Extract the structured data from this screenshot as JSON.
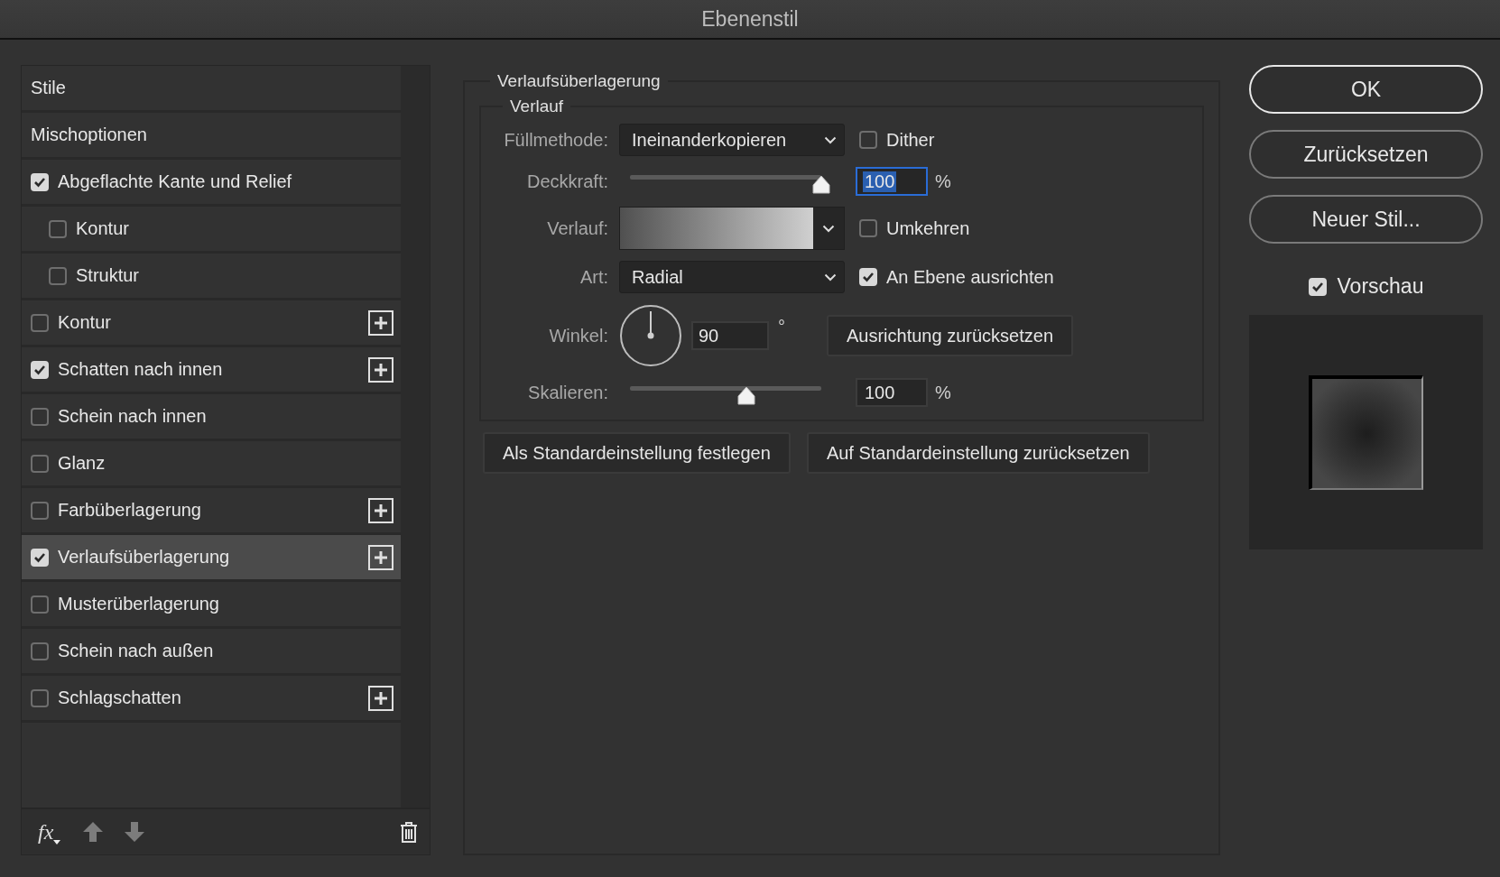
{
  "window": {
    "title": "Ebenenstil"
  },
  "styles_list": {
    "items": [
      {
        "label": "Stile",
        "kind": "plain",
        "selected": false,
        "add_button": false
      },
      {
        "label": "Mischoptionen",
        "kind": "plain",
        "selected": false,
        "add_button": false
      },
      {
        "label": "Abgeflachte Kante und Relief",
        "kind": "check",
        "checked": true,
        "selected": false,
        "add_button": false,
        "children": [
          {
            "label": "Kontur",
            "kind": "check",
            "checked": false,
            "selected": false,
            "add_button": false
          },
          {
            "label": "Struktur",
            "kind": "check",
            "checked": false,
            "selected": false,
            "add_button": false
          }
        ]
      },
      {
        "label": "Kontur",
        "kind": "check",
        "checked": false,
        "selected": false,
        "add_button": true
      },
      {
        "label": "Schatten nach innen",
        "kind": "check",
        "checked": true,
        "selected": false,
        "add_button": true
      },
      {
        "label": "Schein nach innen",
        "kind": "check",
        "checked": false,
        "selected": false,
        "add_button": false
      },
      {
        "label": "Glanz",
        "kind": "check",
        "checked": false,
        "selected": false,
        "add_button": false
      },
      {
        "label": "Farbüberlagerung",
        "kind": "check",
        "checked": false,
        "selected": false,
        "add_button": true
      },
      {
        "label": "Verlaufsüberlagerung",
        "kind": "check",
        "checked": true,
        "selected": true,
        "add_button": true
      },
      {
        "label": "Musterüberlagerung",
        "kind": "check",
        "checked": false,
        "selected": false,
        "add_button": false
      },
      {
        "label": "Schein nach außen",
        "kind": "check",
        "checked": false,
        "selected": false,
        "add_button": false
      },
      {
        "label": "Schlagschatten",
        "kind": "check",
        "checked": false,
        "selected": false,
        "add_button": true
      }
    ],
    "footer": {
      "effects_button": "fx"
    }
  },
  "settings": {
    "title": "Verlaufsüberlagerung",
    "group_title": "Verlauf",
    "blend_mode": {
      "label": "Füllmethode:",
      "value": "Ineinanderkopieren"
    },
    "dither": {
      "label": "Dither",
      "checked": false
    },
    "opacity": {
      "label": "Deckkraft:",
      "level": 1,
      "value": "100",
      "unit": "%",
      "focused": true
    },
    "gradient": {
      "label": "Verlauf:"
    },
    "reverse": {
      "label": "Umkehren",
      "checked": false
    },
    "style": {
      "label": "Art:",
      "value": "Radial"
    },
    "align_with_layer": {
      "label": "An Ebene ausrichten",
      "checked": true
    },
    "angle": {
      "label": "Winkel:",
      "value": "90",
      "unit": "°"
    },
    "reset_alignment": "Ausrichtung zurücksetzen",
    "scale": {
      "label": "Skalieren:",
      "level": 0.61,
      "value": "100",
      "unit": "%",
      "focused": false
    },
    "buttons": [
      "Als Standardeinstellung festlegen",
      "Auf Standardeinstellung zurücksetzen"
    ]
  },
  "actions": {
    "buttons": [
      {
        "label": "OK",
        "default": true
      },
      {
        "label": "Zurücksetzen",
        "default": false
      },
      {
        "label": "Neuer Stil...",
        "default": false
      }
    ],
    "preview": {
      "label": "Vorschau",
      "checked": true
    }
  }
}
